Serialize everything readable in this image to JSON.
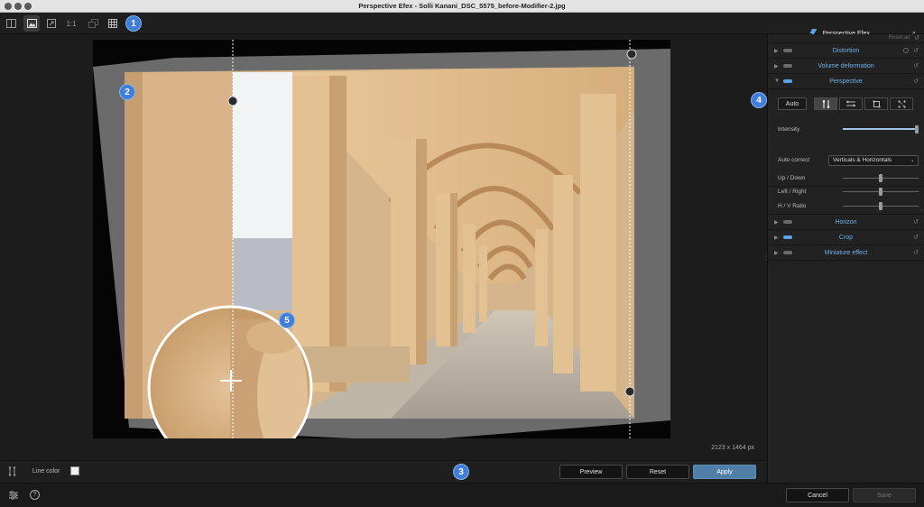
{
  "window": {
    "title": "Perspective Efex - Solli Kanani_DSC_5575_before-Modifier-2.jpg"
  },
  "toolbar": {
    "tools": [
      {
        "name": "compare-icon",
        "glyph": "⊟"
      },
      {
        "name": "image-view-icon",
        "glyph": "▣"
      },
      {
        "name": "fit-icon",
        "glyph": "⤢"
      },
      {
        "name": "zoom-1-1",
        "glyph": "1:1"
      },
      {
        "name": "layers-icon",
        "glyph": "❐"
      },
      {
        "name": "grid-icon",
        "glyph": "▦"
      }
    ],
    "app_name": "Perspective Efex"
  },
  "badges": {
    "b1": "1",
    "b2": "2",
    "b3": "3",
    "b4": "4",
    "b5": "5"
  },
  "canvas": {
    "dimensions": "2123 x 1464 px"
  },
  "bottom_bar": {
    "line_color_label": "Line color",
    "preview": "Preview",
    "reset": "Reset",
    "apply": "Apply"
  },
  "footer": {
    "cancel": "Cancel",
    "save": "Save"
  },
  "panel": {
    "reset_all": "Reset all",
    "sections": {
      "distortion": "Distortion",
      "volume": "Volume deformation",
      "perspective": "Perspective",
      "horizon": "Horizon",
      "crop": "Crop",
      "miniature": "Miniature effect"
    },
    "perspective": {
      "auto": "Auto",
      "intensity_label": "Intensity",
      "intensity": 1.0,
      "auto_correct_label": "Auto correct",
      "auto_correct_value": "Verticals & Horizontals",
      "up_down_label": "Up / Down",
      "up_down": 0.5,
      "left_right_label": "Left / Right",
      "left_right": 0.5,
      "hv_ratio_label": "H / V Ratio",
      "hv_ratio": 0.5
    }
  },
  "colors": {
    "accent": "#3f7fd9",
    "section_label": "#6fb0ea",
    "apply_button": "#4f7ea6"
  }
}
